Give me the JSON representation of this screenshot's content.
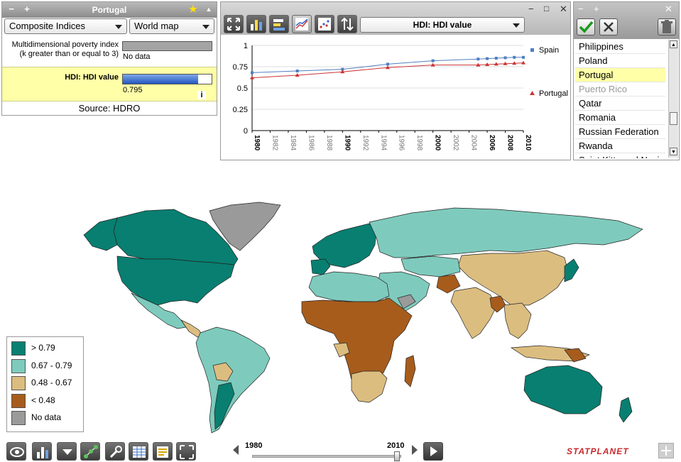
{
  "info_panel": {
    "title": "Portugal",
    "indicator_category": "Composite Indices",
    "map_type": "World map",
    "rows": [
      {
        "label": "Multidimensional poverty index (k greater than or equal to 3)",
        "value": "No data",
        "fill": 0
      },
      {
        "label": "HDI: HDI value",
        "value": "0.795",
        "fill": 0.85
      }
    ],
    "info_icon": "i",
    "source": "Source: HDRO"
  },
  "chart_panel": {
    "indicator": "HDI: HDI value",
    "toolbar_icons": [
      "fullscreen-icon",
      "bar-chart-icon",
      "horizontal-bar-icon",
      "line-chart-icon",
      "scatter-icon",
      "sort-icon"
    ]
  },
  "chart_data": {
    "type": "line",
    "title": "",
    "xlabel": "",
    "ylabel": "",
    "ylim": [
      0,
      1
    ],
    "xlim": [
      1980,
      2010
    ],
    "y_ticks": [
      "0",
      "0.25",
      "0.5",
      "0.75",
      "1"
    ],
    "x_ticks": [
      "1980",
      "1982",
      "1984",
      "1986",
      "1988",
      "1990",
      "1992",
      "1994",
      "1996",
      "1998",
      "2000",
      "2002",
      "2004",
      "2006",
      "2008",
      "2010"
    ],
    "bold_x_ticks": [
      "1980",
      "1990",
      "2000",
      "2006",
      "2008",
      "2010"
    ],
    "grid": true,
    "legend": "right",
    "series": [
      {
        "name": "Spain",
        "color": "#4f7fc0",
        "marker": "square",
        "x": [
          1980,
          1985,
          1990,
          1995,
          2000,
          2005,
          2006,
          2007,
          2008,
          2009,
          2010
        ],
        "y": [
          0.68,
          0.7,
          0.72,
          0.78,
          0.82,
          0.84,
          0.845,
          0.85,
          0.855,
          0.86,
          0.86
        ]
      },
      {
        "name": "Portugal",
        "color": "#cc3333",
        "marker": "triangle",
        "x": [
          1980,
          1985,
          1990,
          1995,
          2000,
          2005,
          2006,
          2007,
          2008,
          2009,
          2010
        ],
        "y": [
          0.62,
          0.65,
          0.69,
          0.74,
          0.77,
          0.77,
          0.775,
          0.78,
          0.785,
          0.79,
          0.795
        ]
      }
    ]
  },
  "country_list": {
    "items": [
      "Philippines",
      "Poland",
      "Portugal",
      "Puerto Rico",
      "Qatar",
      "Romania",
      "Russian Federation",
      "Rwanda",
      "Saint Kitts and Nevis"
    ],
    "selected": "Portugal",
    "disabled": [
      "Puerto Rico"
    ]
  },
  "legend": {
    "items": [
      {
        "label": "> 0.79",
        "color": "#087f71"
      },
      {
        "label": "0.67 - 0.79",
        "color": "#7ecbbd"
      },
      {
        "label": "0.48 - 0.67",
        "color": "#dcbd80"
      },
      {
        "label": "< 0.48",
        "color": "#a75c1c"
      },
      {
        "label": "No data",
        "color": "#9a9a9a"
      }
    ]
  },
  "timeline": {
    "start_label": "1980",
    "end_label": "2010",
    "position": 1.0
  },
  "brand": "STATPLANET",
  "colors": {
    "high": "#087f71",
    "mid_high": "#7ecbbd",
    "mid_low": "#dcbd80",
    "low": "#a75c1c",
    "nodata": "#9a9a9a",
    "selected_row": "#ffffa8"
  }
}
